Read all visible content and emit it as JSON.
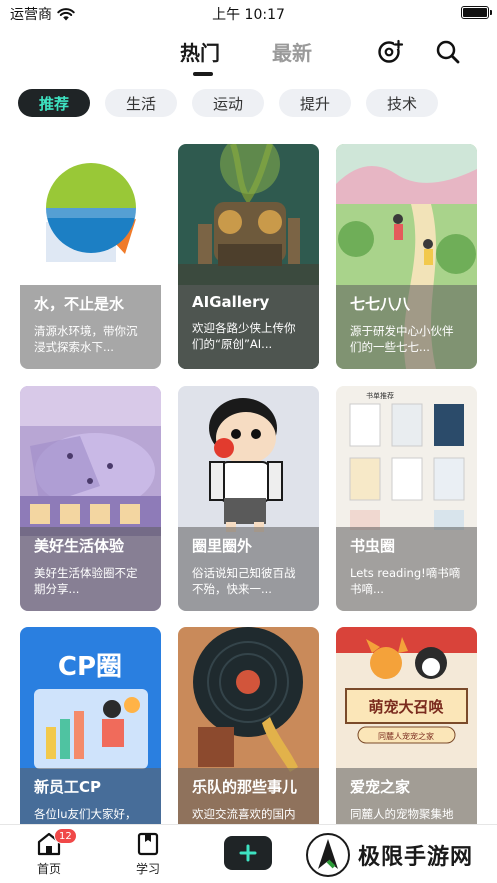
{
  "status_bar": {
    "carrier": "运营商",
    "time": "上午 10:17"
  },
  "header": {
    "tab_hot": "热门",
    "tab_new": "最新"
  },
  "categories": [
    "推荐",
    "生活",
    "运动",
    "提升",
    "技术"
  ],
  "cards": [
    {
      "title": "水，不止是水",
      "desc": "清源水环境，带你沉浸式探索水下..."
    },
    {
      "title": "AIGallery",
      "desc": "欢迎各路少侠上传你们的“原创”AI..."
    },
    {
      "title": "七七八八",
      "desc": "源于研发中心小伙伴们的一些七七..."
    },
    {
      "title": "美好生活体验",
      "desc": "美好生活体验圈不定期分享..."
    },
    {
      "title": "圈里圈外",
      "desc": "俗话说知己知彼百战不殆，快来一..."
    },
    {
      "title": "书虫圈",
      "desc": "Lets reading!嘀书嘀书嘀..."
    },
    {
      "title": "新员工CP",
      "desc": "各位lu友们大家好，这里是新员工..."
    },
    {
      "title": "乐队的那些事儿",
      "desc": "欢迎交流喜欢的国内外乐队"
    },
    {
      "title": "爱宠之家",
      "desc": "同麓人的宠物聚集地"
    }
  ],
  "card_art_text": {
    "cp_logo": "CP圈",
    "pet_banner": "萌宠大召唤",
    "pet_sub": "同麓人宠宠之家",
    "books_header": "书单推荐"
  },
  "bottom_nav": {
    "home_label": "首页",
    "home_badge": "12",
    "study_label": "学习"
  },
  "watermark": {
    "text": "极限手游网"
  },
  "colors": {
    "accent": "#3ee3c2",
    "dark": "#1f2426",
    "badge": "#f04848"
  }
}
